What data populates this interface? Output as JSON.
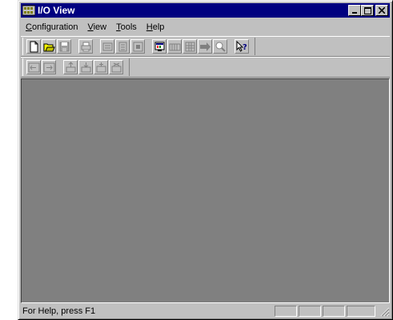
{
  "window": {
    "title": "I/O View"
  },
  "menu": [
    {
      "name": "menu-configuration",
      "label": "Configuration",
      "accel": "C",
      "rest": "onfiguration"
    },
    {
      "name": "menu-view",
      "label": "View",
      "accel": "V",
      "rest": "iew"
    },
    {
      "name": "menu-tools",
      "label": "Tools",
      "accel": "T",
      "rest": "ools"
    },
    {
      "name": "menu-help",
      "label": "Help",
      "accel": "H",
      "rest": "elp"
    }
  ],
  "toolbar1": [
    {
      "name": "new-button",
      "icon": "new-document-icon",
      "enabled": true
    },
    {
      "name": "open-button",
      "icon": "open-folder-icon",
      "enabled": true
    },
    {
      "name": "save-button",
      "icon": "save-disk-icon",
      "enabled": false
    },
    {
      "sep": true
    },
    {
      "name": "print-button",
      "icon": "printer-icon",
      "enabled": false
    },
    {
      "sep": true
    },
    {
      "name": "tool-a-button",
      "icon": "module-icon",
      "enabled": false
    },
    {
      "name": "tool-b-button",
      "icon": "module-properties-icon",
      "enabled": false
    },
    {
      "name": "tool-c-button",
      "icon": "module-config-icon",
      "enabled": false
    },
    {
      "sep": true
    },
    {
      "name": "tool-d-button",
      "icon": "monitor-icon",
      "enabled": true
    },
    {
      "name": "tool-e-button",
      "icon": "rack-icon",
      "enabled": false
    },
    {
      "name": "tool-f-button",
      "icon": "grid-icon",
      "enabled": false
    },
    {
      "name": "tool-g-button",
      "icon": "arrow-right-icon",
      "enabled": false
    },
    {
      "name": "tool-h-button",
      "icon": "magnifier-icon",
      "enabled": false
    },
    {
      "sep": true
    },
    {
      "name": "context-help-button",
      "icon": "help-pointer-icon",
      "enabled": true
    }
  ],
  "toolbar2": [
    {
      "name": "tool-i-button",
      "icon": "node-left-icon",
      "enabled": false
    },
    {
      "name": "tool-j-button",
      "icon": "node-right-icon",
      "enabled": false
    },
    {
      "sep": true
    },
    {
      "name": "tool-k-button",
      "icon": "upload-icon",
      "enabled": false
    },
    {
      "name": "tool-l-button",
      "icon": "download-icon",
      "enabled": false
    },
    {
      "name": "tool-m-button",
      "icon": "insert-icon",
      "enabled": false
    },
    {
      "name": "tool-n-button",
      "icon": "remove-icon",
      "enabled": false
    }
  ],
  "status": {
    "text": "For Help, press F1"
  },
  "colors": {
    "titlebar": "#000080",
    "face": "#c0c0c0",
    "client": "#808080"
  }
}
